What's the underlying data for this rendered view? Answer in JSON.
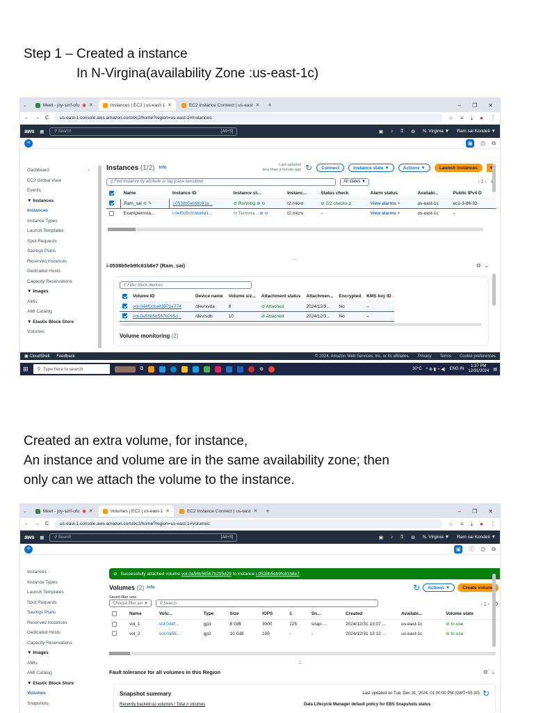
{
  "doc": {
    "step_title": "Step 1 – Created a instance",
    "step_subtitle": "In N-Virgina(availability Zone :us-east-1c)",
    "para_line1": "Created an extra volume, for instance,",
    "para_line2": "An instance and volume are in the same availability zone; then",
    "para_line3": "only can we attach the volume to the instance."
  },
  "shot1": {
    "tabs": [
      {
        "label": "Meet - joy-szrf-ofu"
      },
      {
        "label": "Instances | EC2 | us-east-1"
      },
      {
        "label": "EC2 Instance Connect | us-east"
      }
    ],
    "url": "us-east-1.console.aws.amazon.com/ec2/home?region=us-east-1#Instances:",
    "search_placeholder": "Search",
    "search_kbd": "[Alt+S]",
    "region": "N. Virginia ▼",
    "user": "Ram sai Kondeti ▼",
    "sidebar": [
      "Dashboard",
      "EC2 Global View",
      "Events",
      "▼ Instances",
      "Instances",
      "Instance Types",
      "Launch Templates",
      "Spot Requests",
      "Savings Plans",
      "Reserved Instances",
      "Dedicated Hosts",
      "Capacity Reservations",
      "▼ Images",
      "AMIs",
      "AMI Catalog",
      "▼ Elastic Block Store",
      "Volumes"
    ],
    "title": "Instances",
    "count": "(1/2)",
    "info": "Info",
    "last_updated_1": "Last updated",
    "last_updated_2": "less than a minute ago",
    "btn_connect": "Connect",
    "btn_state": "Instance state ▼",
    "btn_actions": "Actions ▼",
    "btn_launch": "Launch instances",
    "filter_placeholder": "Find Instance by attribute or tag (case-sensitive)",
    "all_states": "All states ▼",
    "pager": "‹  1  ›",
    "columns": [
      "Name",
      "Instance ID",
      "Instance st...",
      "Instanc...",
      "Status check",
      "Alarm status",
      "Availabi...",
      "Public IPv4 D"
    ],
    "rows": [
      [
        "Ram_sai",
        "i-0538b5eb9fc81b...",
        "⊘ Running",
        "t2.micro",
        "⊘ 2/2 checks p:",
        "View alarms +",
        "us-east-1c",
        "ec2-3-86-32-"
      ],
      [
        "ExampleInsta...",
        "i-0ef5d5c0ddd4d1...",
        "⊖ Termina...",
        "t2.micro",
        "–",
        "View alarms +",
        "us-east-1c",
        "–"
      ]
    ],
    "detail_title": "i-0538b5eb9fc81b8e7 (Ram_sai)",
    "block_filter": "Filter block devices",
    "block_columns": [
      "Volume ID",
      "Device name",
      "Volume siz...",
      "Attachment status",
      "Attachmen...",
      "Encrypted",
      "KMS key ID"
    ],
    "block_rows": [
      [
        "vol-044f0cba83971e774",
        "/dev/xvda",
        "8",
        "Attached",
        "2024/12/3...",
        "No",
        "–"
      ],
      [
        "vol-0a56b56567b295d...",
        "/dev/sdb",
        "10",
        "Attached",
        "2024/12/3...",
        "No",
        "–"
      ]
    ],
    "volume_monitoring": "Volume monitoring",
    "volume_monitoring_count": "(2)",
    "footer_left": [
      "CloudShell",
      "Feedback"
    ],
    "footer_right": [
      "© 2024, Amazon Web Services, Inc. or its affiliates.",
      "Privacy",
      "Terms",
      "Cookie preferences"
    ],
    "taskbar_search": "Type here to search",
    "temp": "30°C",
    "lang": "ENG IN",
    "time": "1:37 PM",
    "date": "12/31/2024"
  },
  "shot2": {
    "tabs": [
      {
        "label": "Meet - joy-szrf-ofu"
      },
      {
        "label": "Volumes | EC2 | us-east-1"
      },
      {
        "label": "EC2 Instance Connect | us-east"
      }
    ],
    "url": "us-east-1.console.aws.amazon.com/ec2/home?region=us-east-1#Volumes:",
    "search_placeholder": "Search",
    "search_kbd": "[Alt+S]",
    "region": "N. Virginia ▼",
    "user": "Ram sai Kondeti ▼",
    "sidebar": [
      "Instances",
      "Instance Types",
      "Launch Templates",
      "Spot Requests",
      "Savings Plans",
      "Reserved Instances",
      "Dedicated Hosts",
      "Capacity Reservations",
      "▼ Images",
      "AMIs",
      "AMI Catalog",
      "▼ Elastic Block Store",
      "Volumes",
      "Snapshots"
    ],
    "banner_pre": "Successfully attached volume ",
    "banner_vol": "vol-0a56b56567b295d29",
    "banner_mid": " to instance ",
    "banner_inst": "i-0538b5eb9fc81b8e7",
    "banner_post": ".",
    "title": "Volumes",
    "count": "(2)",
    "info": "Info",
    "btn_actions": "Actions ▼",
    "btn_create": "Create volume",
    "saved_filter_label": "Saved filter sets",
    "saved_filter": "Choose filter set ▼",
    "search": "Search",
    "pager": "‹  1  ›",
    "columns": [
      "Name",
      "Volu...",
      "Type",
      "Size",
      "IOPS",
      "1",
      "Sn...",
      "Created",
      "Availabi...",
      "Volume state"
    ],
    "rows": [
      [
        "vol_1",
        "vol-044f...",
        "gp3",
        "8 GiB",
        "3000",
        "125",
        "snap-...",
        "2024/12/31 13:07 ...",
        "us-east-1c",
        "In-use"
      ],
      [
        "vol_2",
        "vol-0a56...",
        "gp2",
        "10 GiB",
        "100",
        "-",
        "-",
        "2024/12/31 13:12 ...",
        "us-east-1c",
        "In-use"
      ]
    ],
    "fault_title": "Fault tolerance for all volumes in this Region",
    "snapshot_title": "Snapshot summary",
    "snapshot_updated": "Last updated on Tue, Dec 31, 2024, 01:00:00 PM (GMT+05:30)",
    "snapshot_left": "Recently backed up volumes / Total # volumes",
    "snapshot_right": "Data Lifecycle Manager default policy for EBS Snapshots status"
  },
  "colors": {
    "accent": "#0972d3",
    "aws_dark": "#232f3e",
    "orange": "#ff9900",
    "success": "#037f0c"
  }
}
